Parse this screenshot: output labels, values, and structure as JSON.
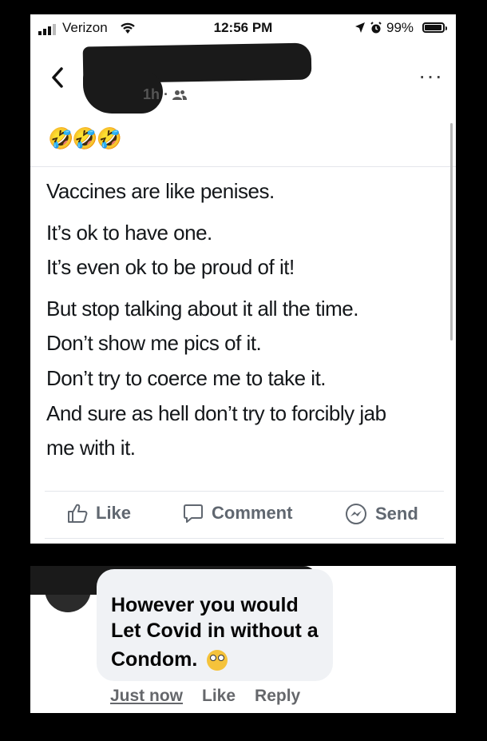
{
  "status_bar": {
    "carrier": "Verizon",
    "time": "12:56 PM",
    "battery": "99%"
  },
  "post": {
    "meta": "1h ·",
    "caption_emojis": "🤣🤣🤣",
    "tweet_lines": [
      "Vaccines are like penises.",
      "It’s ok to have one.",
      "It’s even ok to be proud of it!",
      "But stop talking about it all the time.",
      "Don’t show me pics of it.",
      "Don’t try to coerce me to take it.",
      "And sure as hell don’t try to forcibly jab",
      "me with it."
    ]
  },
  "actions": {
    "like": "Like",
    "comment": "Comment",
    "send": "Send"
  },
  "comment": {
    "line1": "However you would",
    "line2": "Let Covid in without a",
    "line3": "Condom.",
    "time": "Just now",
    "like": "Like",
    "reply": "Reply"
  },
  "colors": {
    "action_gray": "#606770",
    "comment_bubble": "#f0f2f5",
    "redaction": "#1a1a1a"
  }
}
